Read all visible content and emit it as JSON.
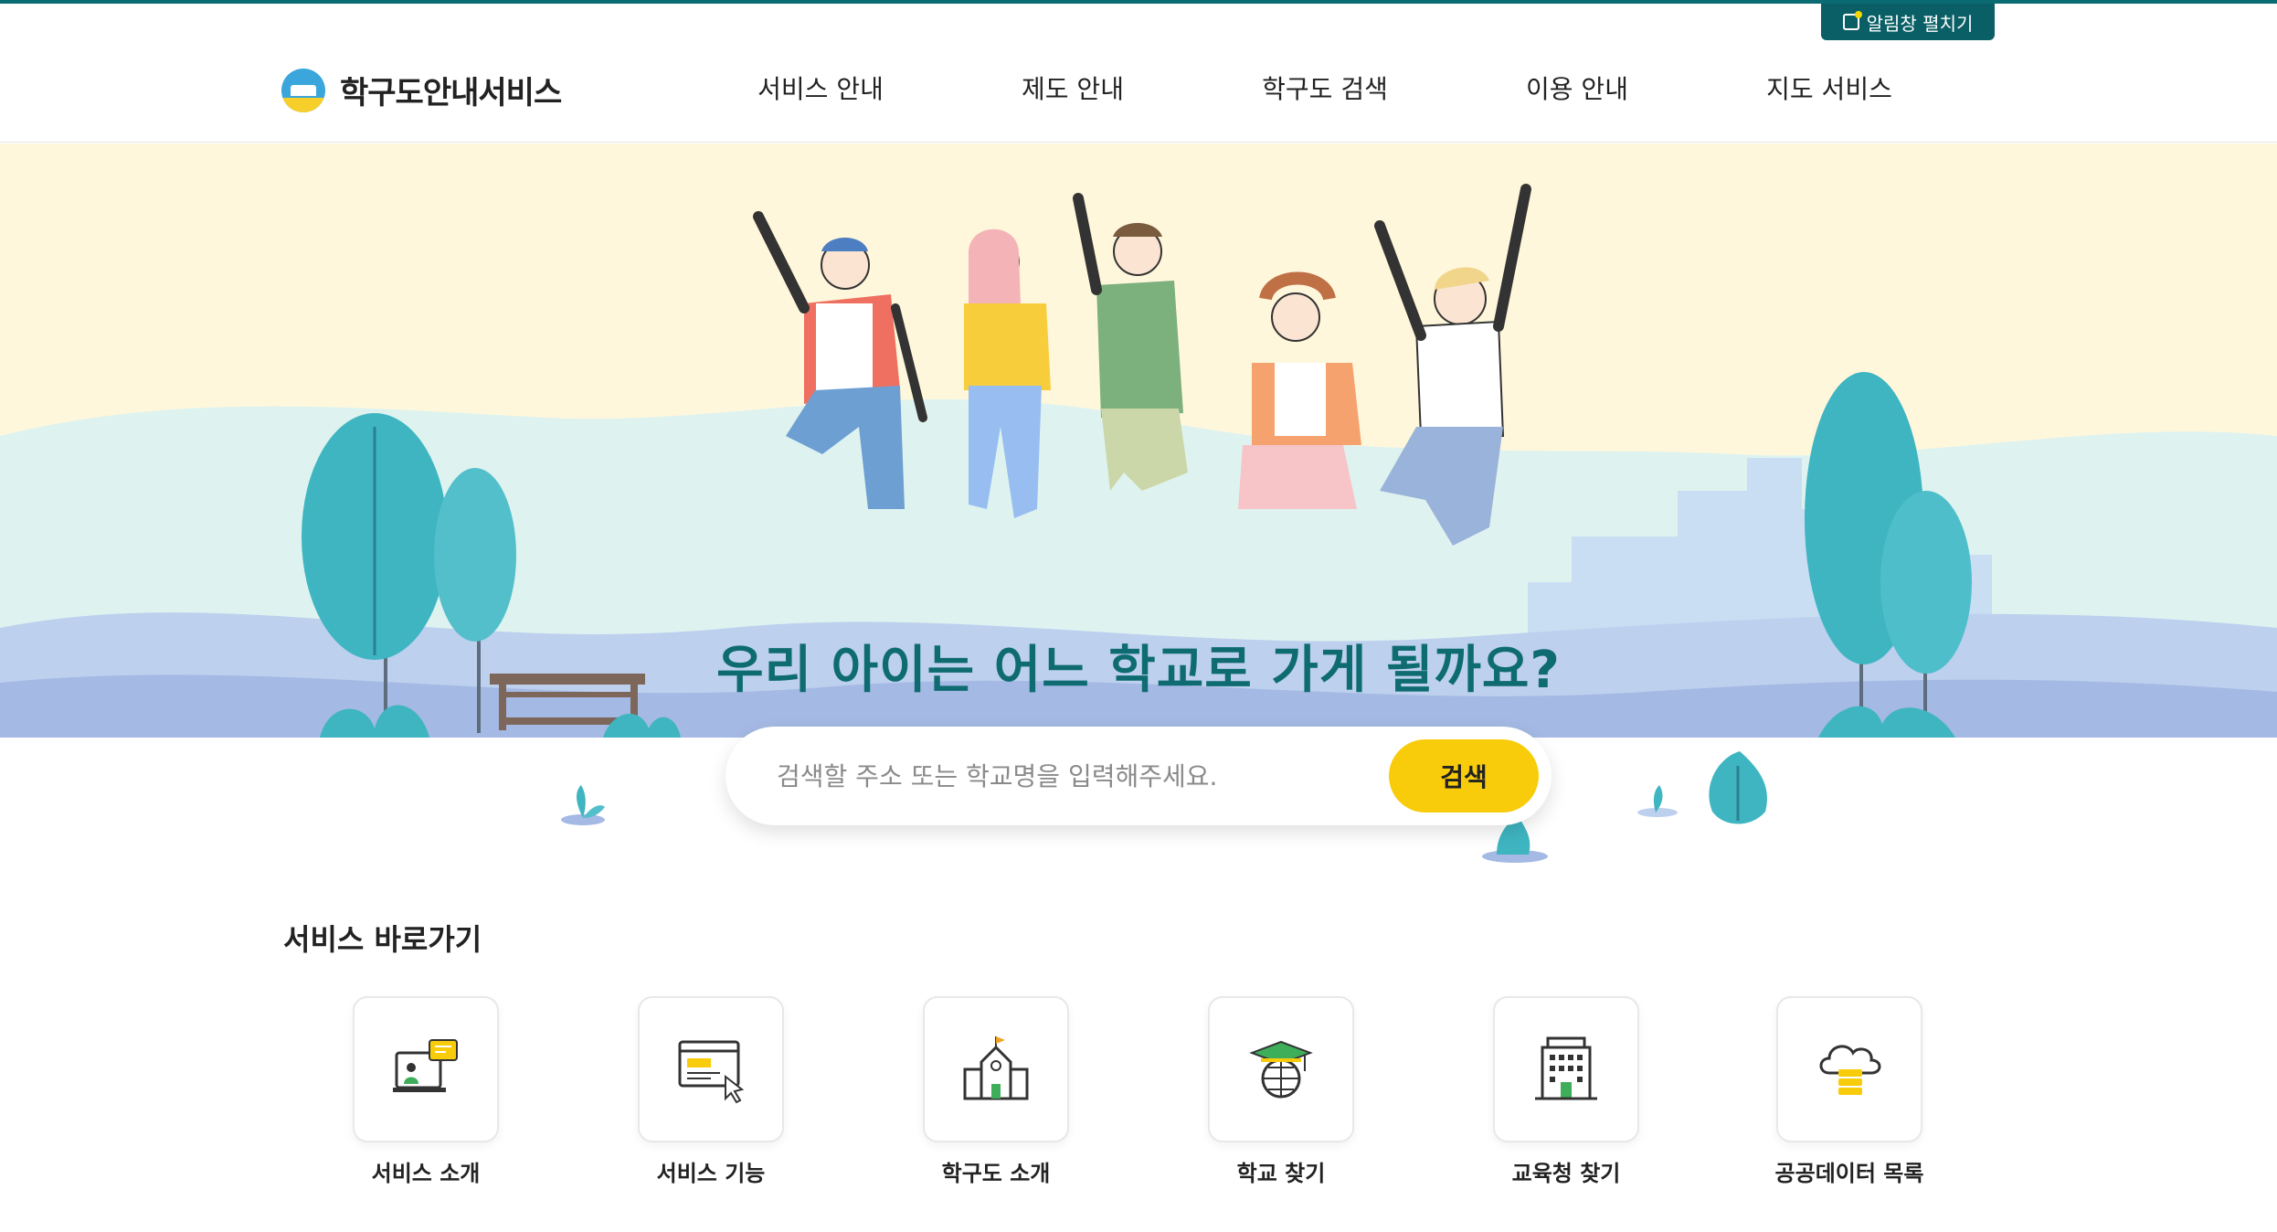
{
  "notice": {
    "label": "알림창 펼치기"
  },
  "brand": {
    "name": "학구도안내서비스"
  },
  "nav": [
    {
      "label": "서비스 안내"
    },
    {
      "label": "제도 안내"
    },
    {
      "label": "학구도 검색"
    },
    {
      "label": "이용 안내"
    },
    {
      "label": "지도 서비스"
    }
  ],
  "hero": {
    "title": "우리 아이는 어느 학교로 가게 될까요?"
  },
  "search": {
    "placeholder": "검색할 주소 또는 학교명을 입력해주세요.",
    "value": "",
    "button_label": "검색"
  },
  "shortcuts": {
    "title": "서비스 바로가기",
    "items": [
      {
        "label": "서비스 소개",
        "icon": "presentation-icon"
      },
      {
        "label": "서비스 기능",
        "icon": "browser-click-icon"
      },
      {
        "label": "학구도 소개",
        "icon": "school-building-icon"
      },
      {
        "label": "학교 찾기",
        "icon": "graduation-globe-icon"
      },
      {
        "label": "교육청 찾기",
        "icon": "office-building-icon"
      },
      {
        "label": "공공데이터 목록",
        "icon": "cloud-database-icon"
      }
    ]
  },
  "colors": {
    "accent": "#0a5f66",
    "title": "#0e6b72",
    "search_button": "#f8cc0a",
    "hero_background": "#fff7dc"
  }
}
